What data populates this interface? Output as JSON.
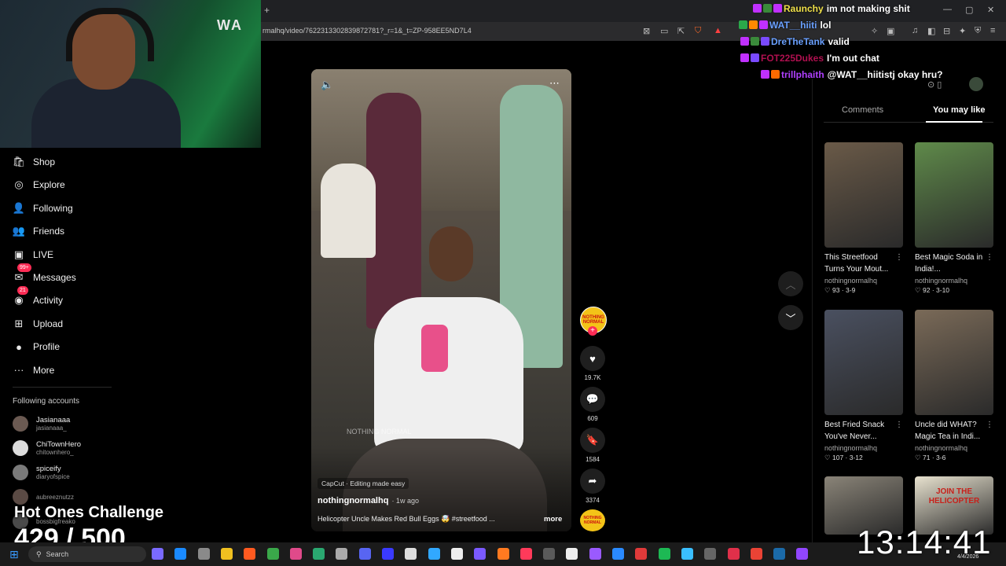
{
  "browser": {
    "url": "rmalhq/video/7622313302839872781?_r=1&_t=ZP-958EE5ND7L4",
    "new_tab": "+",
    "window_controls": [
      "—",
      "▢",
      "✕"
    ]
  },
  "sidebar": {
    "items": [
      {
        "label": "Shop",
        "icon": "shop-icon",
        "glyph": "🛍"
      },
      {
        "label": "Explore",
        "icon": "compass-icon",
        "glyph": "◎"
      },
      {
        "label": "Following",
        "icon": "person-icon",
        "glyph": "👤"
      },
      {
        "label": "Friends",
        "icon": "friends-icon",
        "glyph": "👥"
      },
      {
        "label": "LIVE",
        "icon": "live-icon",
        "glyph": "▣"
      },
      {
        "label": "Messages",
        "icon": "messages-icon",
        "glyph": "✉",
        "badge": "99+"
      },
      {
        "label": "Activity",
        "icon": "activity-icon",
        "glyph": "◉",
        "badge": "21"
      },
      {
        "label": "Upload",
        "icon": "upload-icon",
        "glyph": "⊞"
      },
      {
        "label": "Profile",
        "icon": "profile-icon",
        "glyph": "●"
      },
      {
        "label": "More",
        "icon": "more-icon",
        "glyph": "···"
      }
    ],
    "following_title": "Following accounts",
    "accounts": [
      {
        "name": "Jasianaaa",
        "handle": "jasianaaa_",
        "color": "#6b5a52"
      },
      {
        "name": "ChiTownHero",
        "handle": "chitownhero_",
        "color": "#dcdcdc"
      },
      {
        "name": "spiceify",
        "handle": "diaryofspice",
        "color": "#7a7a7a"
      },
      {
        "name": "",
        "handle": "aubreeznutzz",
        "color": "#5a4a44"
      },
      {
        "name": "",
        "handle": "bossbigfreako",
        "color": "#4a4a4a"
      }
    ]
  },
  "overlay": {
    "challenge": "Hot Ones Challenge",
    "counter": "429 / 500"
  },
  "video": {
    "watermark": "NOTHING NORMAL",
    "capcut": "CapCut · Editing made easy",
    "author": "nothingnormalhq",
    "time": "· 1w ago",
    "description": "Helicopter Uncle Makes Red Bull Eggs 🤯 #streetfood ...",
    "more": "more",
    "likes": "19.7K",
    "comments": "609",
    "saves": "1584",
    "shares": "3374",
    "channel_badge": "NOTHING NORMAL"
  },
  "panel": {
    "tab_comments": "Comments",
    "tab_like": "You may like",
    "cards": [
      {
        "title": "This Streetfood Turns Your Mout...",
        "author": "nothingnormalhq",
        "likes": "93",
        "date": "3-9",
        "color": "#6a5a48"
      },
      {
        "title": "Best Magic Soda in India!...",
        "author": "nothingnormalhq",
        "likes": "92",
        "date": "3-10",
        "color": "#5f8a4a"
      },
      {
        "title": "Best Fried Snack You've Never...",
        "author": "nothingnormalhq",
        "likes": "107",
        "date": "3-12",
        "color": "#4a5060"
      },
      {
        "title": "Uncle did WHAT? Magic Tea in Indi...",
        "author": "nothingnormalhq",
        "likes": "71",
        "date": "3-6",
        "color": "#7a6a58"
      },
      {
        "title": "",
        "author": "",
        "likes": "",
        "date": "",
        "color": "#8a8478"
      },
      {
        "title": "",
        "author": "",
        "likes": "",
        "date": "",
        "color": "#e8e2cf"
      }
    ],
    "thumb5_text": "JOIN THE HELICOPTER"
  },
  "chat": [
    {
      "user": "Raunchy",
      "msg": "im not making shit",
      "color": "#f0e14a"
    },
    {
      "user": "WAT__hiiti",
      "msg": "lol",
      "color": "#6aa0ff"
    },
    {
      "user": "DreTheTank",
      "msg": "valid",
      "color": "#6aa0ff"
    },
    {
      "user": "FOT225Dukes",
      "msg": "I'm out chat",
      "color": "#b01050"
    },
    {
      "user": "trillphaith",
      "msg": "@WAT__hiitistj okay hru?",
      "color": "#b040ff"
    }
  ],
  "taskbar": {
    "search": "Search",
    "clock": "13:14:41",
    "date": "4/4/2026"
  },
  "colors": {
    "accent": "#fe2c55",
    "background": "#000000"
  }
}
